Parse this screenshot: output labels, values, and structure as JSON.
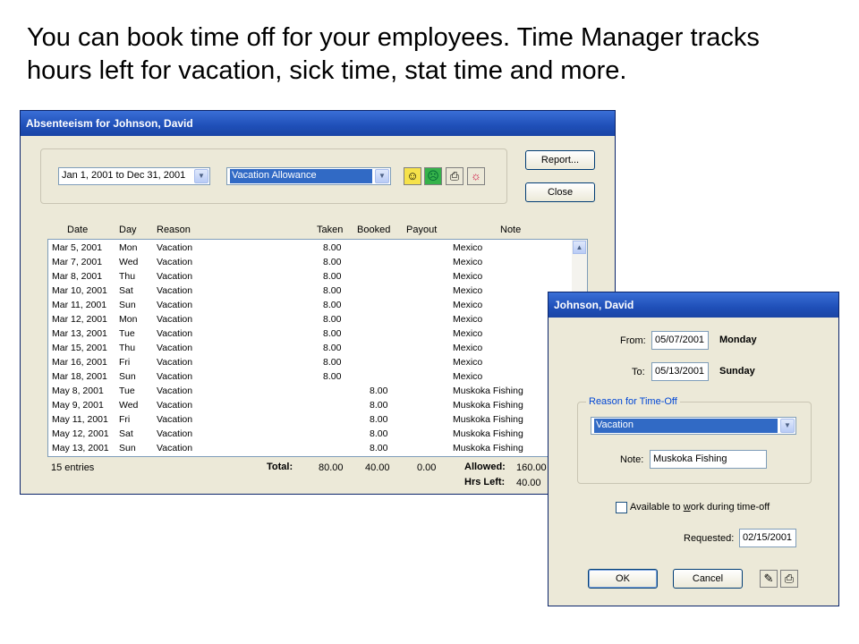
{
  "caption": {
    "line1": "You can book time off for your employees. Time Manager tracks",
    "line2": "hours left for vacation, sick time, stat time and more."
  },
  "absenteeism": {
    "title": "Absenteeism for Johnson, David",
    "date_range": "Jan 1, 2001 to Dec 31, 2001",
    "allowance_type": "Vacation Allowance",
    "report_button": "Report...",
    "close_button": "Close",
    "icons": [
      "smiley-face-icon",
      "sad-face-icon",
      "printer-icon",
      "sun-icon"
    ],
    "columns": [
      "Date",
      "Day",
      "Reason",
      "Taken",
      "Booked",
      "Payout",
      "Note"
    ],
    "rows": [
      {
        "date": "Mar 5, 2001",
        "day": "Mon",
        "reason": "Vacation",
        "taken": "8.00",
        "booked": "",
        "note": "Mexico"
      },
      {
        "date": "Mar 7, 2001",
        "day": "Wed",
        "reason": "Vacation",
        "taken": "8.00",
        "booked": "",
        "note": "Mexico"
      },
      {
        "date": "Mar 8, 2001",
        "day": "Thu",
        "reason": "Vacation",
        "taken": "8.00",
        "booked": "",
        "note": "Mexico"
      },
      {
        "date": "Mar 10, 2001",
        "day": "Sat",
        "reason": "Vacation",
        "taken": "8.00",
        "booked": "",
        "note": "Mexico"
      },
      {
        "date": "Mar 11, 2001",
        "day": "Sun",
        "reason": "Vacation",
        "taken": "8.00",
        "booked": "",
        "note": "Mexico"
      },
      {
        "date": "Mar 12, 2001",
        "day": "Mon",
        "reason": "Vacation",
        "taken": "8.00",
        "booked": "",
        "note": "Mexico"
      },
      {
        "date": "Mar 13, 2001",
        "day": "Tue",
        "reason": "Vacation",
        "taken": "8.00",
        "booked": "",
        "note": "Mexico"
      },
      {
        "date": "Mar 15, 2001",
        "day": "Thu",
        "reason": "Vacation",
        "taken": "8.00",
        "booked": "",
        "note": "Mexico"
      },
      {
        "date": "Mar 16, 2001",
        "day": "Fri",
        "reason": "Vacation",
        "taken": "8.00",
        "booked": "",
        "note": "Mexico"
      },
      {
        "date": "Mar 18, 2001",
        "day": "Sun",
        "reason": "Vacation",
        "taken": "8.00",
        "booked": "",
        "note": "Mexico"
      },
      {
        "date": "May 8, 2001",
        "day": "Tue",
        "reason": "Vacation",
        "taken": "",
        "booked": "8.00",
        "note": "Muskoka Fishing"
      },
      {
        "date": "May 9, 2001",
        "day": "Wed",
        "reason": "Vacation",
        "taken": "",
        "booked": "8.00",
        "note": "Muskoka Fishing"
      },
      {
        "date": "May 11, 2001",
        "day": "Fri",
        "reason": "Vacation",
        "taken": "",
        "booked": "8.00",
        "note": "Muskoka Fishing"
      },
      {
        "date": "May 12, 2001",
        "day": "Sat",
        "reason": "Vacation",
        "taken": "",
        "booked": "8.00",
        "note": "Muskoka Fishing"
      },
      {
        "date": "May 13, 2001",
        "day": "Sun",
        "reason": "Vacation",
        "taken": "",
        "booked": "8.00",
        "note": "Muskoka Fishing"
      }
    ],
    "entries": "15 entries",
    "total_label": "Total:",
    "total_taken": "80.00",
    "total_booked": "40.00",
    "total_payout": "0.00",
    "allowed_label": "Allowed:",
    "allowed_value": "160.00",
    "hrs_left_label": "Hrs Left:",
    "hrs_left_value": "40.00"
  },
  "timeoff": {
    "title": "Johnson, David",
    "from_label": "From:",
    "from_value": "05/07/2001",
    "from_day": "Monday",
    "to_label": "To:",
    "to_value": "05/13/2001",
    "to_day": "Sunday",
    "reason_group": "Reason for Time-Off",
    "reason_value": "Vacation",
    "note_label": "Note:",
    "note_value": "Muskoka Fishing",
    "available_label_pre": "Available to ",
    "available_label_u": "w",
    "available_label_post": "ork during time-off",
    "requested_label": "Requested:",
    "requested_value": "02/15/2001",
    "ok_button": "OK",
    "cancel_button": "Cancel",
    "icons": [
      "notepad-icon",
      "printer-icon"
    ]
  }
}
